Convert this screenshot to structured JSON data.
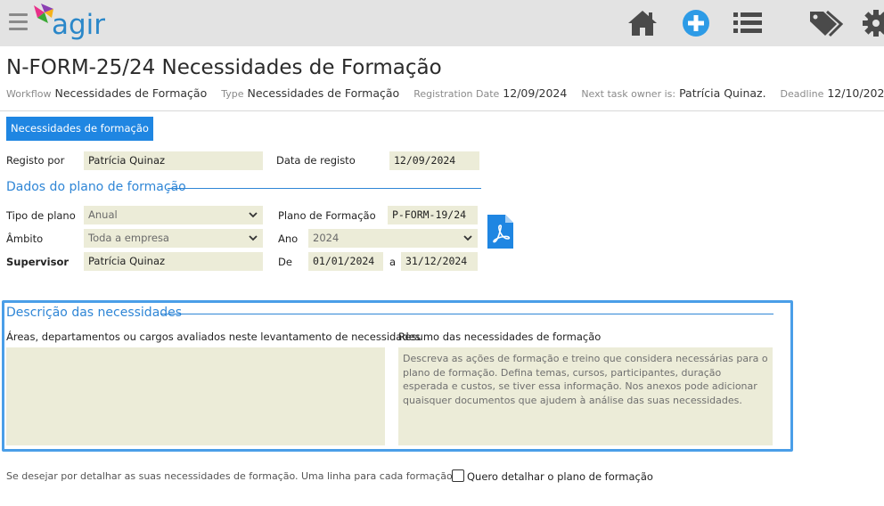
{
  "header": {
    "brand": "agir",
    "nav_icons": [
      "home-icon",
      "add-circle-icon",
      "list-icon",
      "tags-icon",
      "gear-icon"
    ],
    "brand_color": "#2a87c9",
    "accent_color": "#1f86e2"
  },
  "title": "N-FORM-25/24 Necessidades de Formação",
  "meta": {
    "workflow_label": "Workflow",
    "workflow_value": "Necessidades de Formação",
    "type_label": "Type",
    "type_value": "Necessidades de Formação",
    "registration_label": "Registration Date",
    "registration_value": "12/09/2024",
    "owner_label": "Next task owner is:",
    "owner_value": "Patrícia Quinaz.",
    "deadline_label": "Deadline",
    "deadline_value": "12/10/2024"
  },
  "tab": {
    "label": "Necessidades de formação"
  },
  "form": {
    "registo_por_label": "Registo por",
    "registo_por_value": "Patrícia Quinaz",
    "data_registo_label": "Data de registo",
    "data_registo_value": "12/09/2024",
    "section_plano": "Dados do plano de formação",
    "tipo_plano_label": "Tipo de plano",
    "tipo_plano_value": "Anual",
    "plano_formacao_label": "Plano de Formação",
    "plano_formacao_value": "P-FORM-19/24",
    "ambito_label": "Âmbito",
    "ambito_value": "Toda a empresa",
    "ano_label": "Ano",
    "ano_value": "2024",
    "supervisor_label": "Supervisor",
    "supervisor_value": "Patrícia Quinaz",
    "de_label": "De",
    "de_value": "01/01/2024",
    "a_label": "a",
    "a_value": "31/12/2024"
  },
  "descricao": {
    "section_title": "Descrição das necessidades",
    "areas_label": "Áreas, departamentos ou cargos avaliados neste levantamento de necessidades",
    "areas_value": "",
    "resumo_label": "Resumo das necessidades de formação",
    "resumo_placeholder": "Descreva as ações de formação e treino que considera necessárias para o plano de formação. Defina temas, cursos, participantes, duração esperada e custos, se tiver essa informação. Nos anexos pode adicionar quaisquer documentos que ajudem à análise das suas necessidades."
  },
  "footer": {
    "note": "Se desejar por detalhar as suas necessidades de formação. Uma linha para cada formação.",
    "checkbox_label": "Quero detalhar o plano de formação"
  }
}
